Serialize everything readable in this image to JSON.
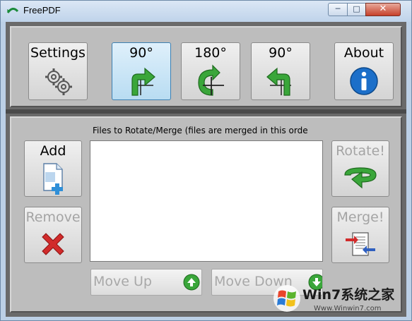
{
  "window": {
    "title": "FreePDF",
    "controls": {
      "minimize": "─",
      "maximize": "□",
      "close": "✕"
    }
  },
  "toolbar": {
    "settings_label": "Settings",
    "rotate_right_label": "90°",
    "rotate_180_label": "180°",
    "rotate_left_label": "90°",
    "about_label": "About",
    "active": "rotate_right"
  },
  "files": {
    "header": "Files to Rotate/Merge (files are merged in this orde",
    "items": []
  },
  "actions": {
    "add_label": "Add",
    "remove_label": "Remove",
    "rotate_label": "Rotate!",
    "merge_label": "Merge!",
    "move_up_label": "Move Up",
    "move_down_label": "Move Down"
  },
  "watermark": {
    "brand": "Win7系统之家",
    "url": "Www.Winwin7.com"
  },
  "colors": {
    "arrow_green": "#3aa63a",
    "info_blue": "#1c6fc9",
    "remove_red": "#d12b2b",
    "active_blue": "#b8dcf2"
  }
}
